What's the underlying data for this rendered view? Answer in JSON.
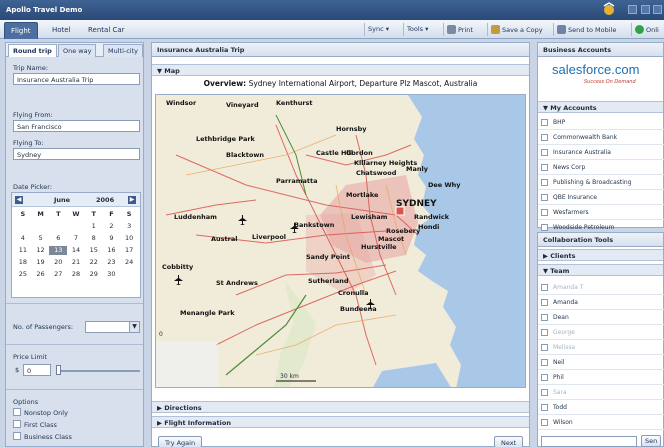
{
  "app": {
    "title": "Apollo Travel Demo"
  },
  "nav": {
    "tabs": [
      "Flight",
      "Hotel",
      "Rental Car"
    ]
  },
  "toolbar": {
    "sync": "Sync ▾",
    "tools": "Tools ▾",
    "print": "Print",
    "save_copy": "Save a Copy",
    "send_mobile": "Send to Mobile",
    "online": "Onli"
  },
  "left": {
    "tabs": [
      "Round trip",
      "One way",
      "Multi-city"
    ],
    "trip_name_label": "Trip Name:",
    "trip_name_value": "Insurance Australia Trip",
    "flying_from_label": "Flying From:",
    "flying_from_value": "San Francisco",
    "flying_to_label": "Flying To:",
    "flying_to_value": "Sydney",
    "date_picker_label": "Date Picker:",
    "calendar": {
      "month": "June",
      "year": "2006",
      "days_of_week": [
        "S",
        "M",
        "T",
        "W",
        "T",
        "F",
        "S"
      ],
      "weeks": [
        [
          "",
          "",
          "",
          "",
          "1",
          "2",
          "3"
        ],
        [
          "4",
          "5",
          "6",
          "7",
          "8",
          "9",
          "10"
        ],
        [
          "11",
          "12",
          "13",
          "14",
          "15",
          "16",
          "17"
        ],
        [
          "18",
          "19",
          "20",
          "21",
          "22",
          "23",
          "24"
        ],
        [
          "25",
          "26",
          "27",
          "28",
          "29",
          "30",
          ""
        ]
      ],
      "selected": "13"
    },
    "passengers_label": "No. of Passengers:",
    "price_limit_label": "Price Limit",
    "price_currency": "$",
    "price_value": "0",
    "options_label": "Options",
    "options": [
      "Nonstop Only",
      "First Class",
      "Business Class"
    ]
  },
  "center": {
    "panel_title": "Insurance Australia Trip",
    "map_section": "Map",
    "overview_label": "Overview:",
    "overview_text": "Sydney International Airport, Departure Plz Mascot, Australia",
    "map": {
      "places": [
        "Windsor",
        "Vineyard",
        "Kenthurst",
        "Hornsby",
        "Lethbridge Park",
        "Blacktown",
        "Castle Hill",
        "Gordon",
        "Killarney Heights",
        "Chatswood",
        "Manly",
        "Parramatta",
        "Mortlake",
        "Dee Why",
        "SYDNEY",
        "Luddenham",
        "Austral",
        "Liverpool",
        "Bankstown",
        "Lewisham",
        "Randwick",
        "Hurstville",
        "Sandy Point",
        "Cobbitty",
        "St Andrews",
        "Sutherland",
        "Menangle Park",
        "Cronulla",
        "Bundeena",
        "Hondi",
        "Rosebery",
        "Mascot"
      ],
      "scale_text": "30 km"
    },
    "directions_section": "Directions",
    "flight_info_section": "Flight Information",
    "try_again": "Try Again",
    "next": "Next"
  },
  "right": {
    "header": "Business Accounts",
    "brand_text": "salesforce.com",
    "brand_tagline": "Success On Demand",
    "my_accounts_header": "My Accounts",
    "accounts": [
      "BHP",
      "Commonwealth Bank",
      "Insurance Australia",
      "News Corp",
      "Publishing & Broadcasting",
      "QBE Insurance",
      "Wesfarmers",
      "Woodside Petroleum"
    ],
    "collab_header": "Collaboration Tools",
    "clients_section": "Clients",
    "team_section": "Team",
    "team": [
      {
        "name": "Amanda T",
        "faded": true
      },
      {
        "name": "Amanda",
        "faded": false
      },
      {
        "name": "Dean",
        "faded": false
      },
      {
        "name": "George",
        "faded": true
      },
      {
        "name": "Melissa",
        "faded": true
      },
      {
        "name": "Neil",
        "faded": false
      },
      {
        "name": "Phil",
        "faded": false
      },
      {
        "name": "Sara",
        "faded": true
      },
      {
        "name": "Todd",
        "faded": false
      },
      {
        "name": "Wilson",
        "faded": false
      }
    ],
    "send_button": "Sen"
  },
  "colors": {
    "accent": "#4c6ea0",
    "map_water": "#a9c8e8",
    "map_land": "#f1ecd9",
    "roads": "#d9534f"
  }
}
